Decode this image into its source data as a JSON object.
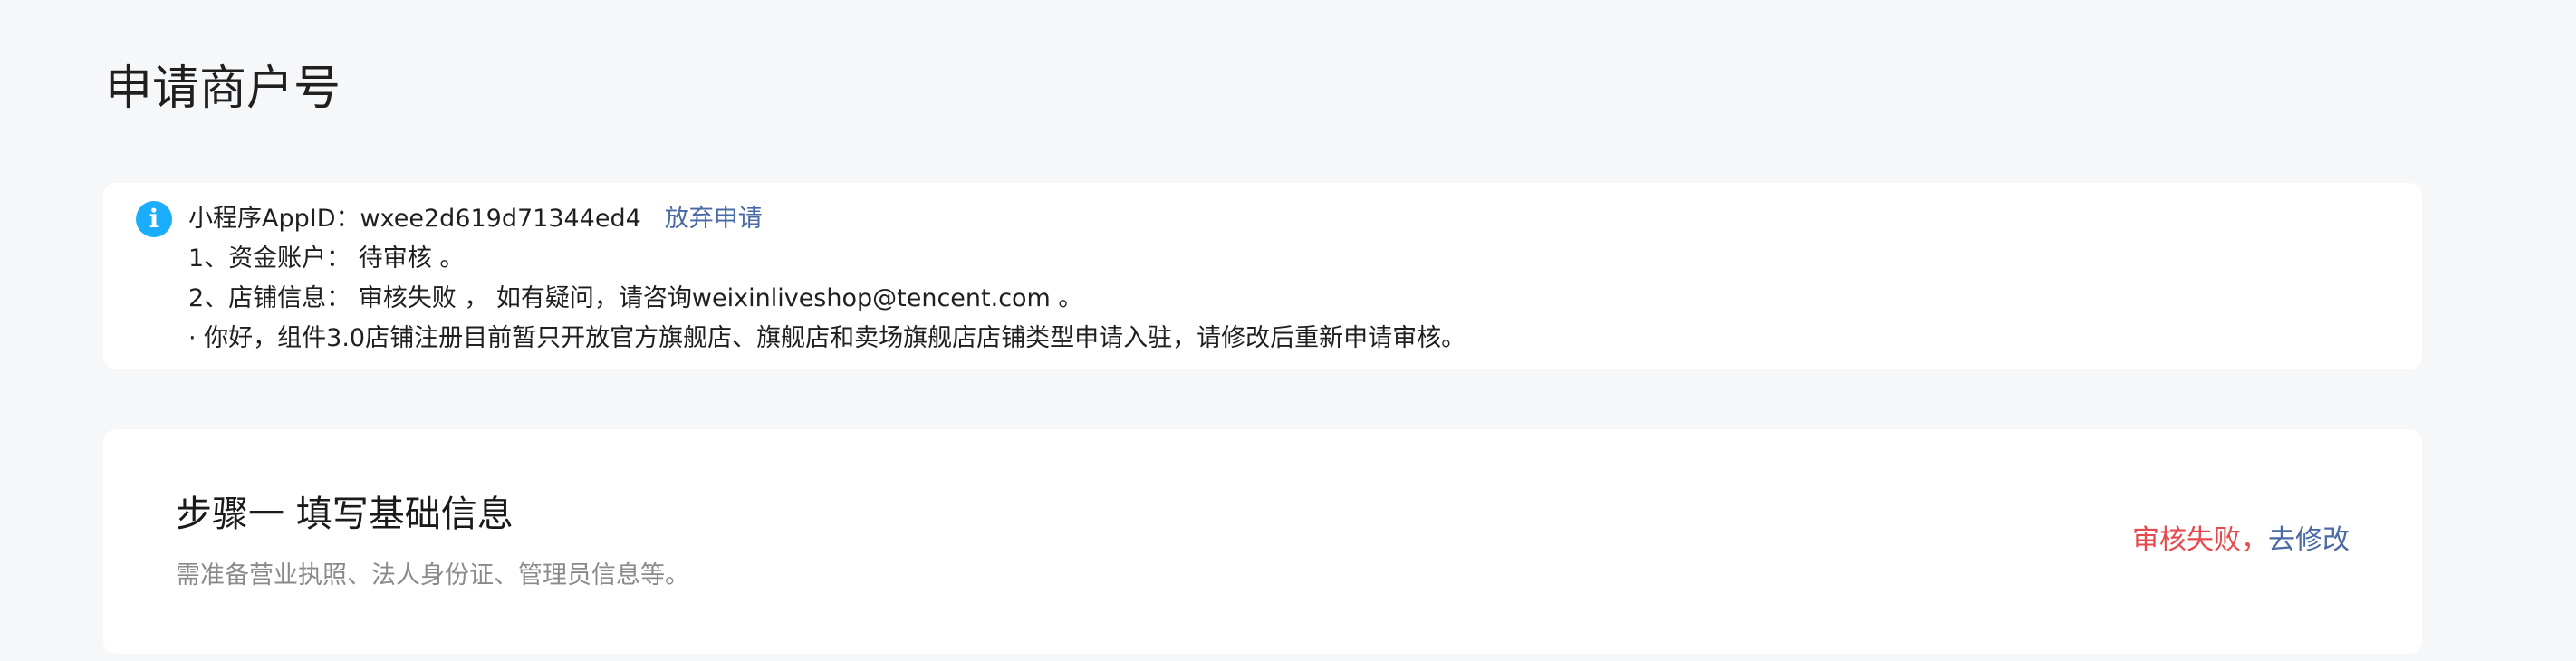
{
  "page": {
    "title": "申请商户号"
  },
  "notice": {
    "icon": "info-icon",
    "icon_glyph": "i",
    "appid_label": "小程序AppID：",
    "appid_value": "wxee2d619d71344ed4",
    "abandon_link": "放弃申请",
    "line2": "1、资金账户： 待审核 。",
    "line3": "2、店铺信息： 审核失败 ，  如有疑问，请咨询weixinliveshop@tencent.com 。",
    "line4": "· 你好，组件3.0店铺注册目前暂只开放官方旗舰店、旗舰店和卖场旗舰店店铺类型申请入驻，请修改后重新申请审核。"
  },
  "step": {
    "title": "步骤一 填写基础信息",
    "description": "需准备营业执照、法人身份证、管理员信息等。",
    "status_fail": "审核失败，",
    "status_link": "去修改"
  },
  "colors": {
    "background": "#f6f7f9",
    "card": "#ffffff",
    "info_icon": "#1aadfa",
    "link": "#4a6aa5",
    "fail": "#e5484d",
    "muted": "#8a8a8a"
  }
}
